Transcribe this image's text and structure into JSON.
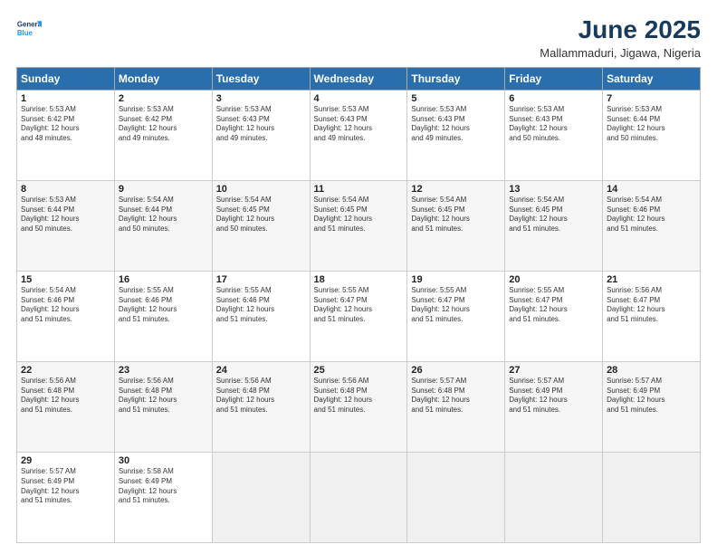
{
  "header": {
    "logo_line1": "General",
    "logo_line2": "Blue",
    "title": "June 2025",
    "subtitle": "Mallammaduri, Jigawa, Nigeria"
  },
  "days_of_week": [
    "Sunday",
    "Monday",
    "Tuesday",
    "Wednesday",
    "Thursday",
    "Friday",
    "Saturday"
  ],
  "weeks": [
    [
      {
        "day": "1",
        "detail": "Sunrise: 5:53 AM\nSunset: 6:42 PM\nDaylight: 12 hours\nand 48 minutes."
      },
      {
        "day": "2",
        "detail": "Sunrise: 5:53 AM\nSunset: 6:42 PM\nDaylight: 12 hours\nand 49 minutes."
      },
      {
        "day": "3",
        "detail": "Sunrise: 5:53 AM\nSunset: 6:43 PM\nDaylight: 12 hours\nand 49 minutes."
      },
      {
        "day": "4",
        "detail": "Sunrise: 5:53 AM\nSunset: 6:43 PM\nDaylight: 12 hours\nand 49 minutes."
      },
      {
        "day": "5",
        "detail": "Sunrise: 5:53 AM\nSunset: 6:43 PM\nDaylight: 12 hours\nand 49 minutes."
      },
      {
        "day": "6",
        "detail": "Sunrise: 5:53 AM\nSunset: 6:43 PM\nDaylight: 12 hours\nand 50 minutes."
      },
      {
        "day": "7",
        "detail": "Sunrise: 5:53 AM\nSunset: 6:44 PM\nDaylight: 12 hours\nand 50 minutes."
      }
    ],
    [
      {
        "day": "8",
        "detail": "Sunrise: 5:53 AM\nSunset: 6:44 PM\nDaylight: 12 hours\nand 50 minutes."
      },
      {
        "day": "9",
        "detail": "Sunrise: 5:54 AM\nSunset: 6:44 PM\nDaylight: 12 hours\nand 50 minutes."
      },
      {
        "day": "10",
        "detail": "Sunrise: 5:54 AM\nSunset: 6:45 PM\nDaylight: 12 hours\nand 50 minutes."
      },
      {
        "day": "11",
        "detail": "Sunrise: 5:54 AM\nSunset: 6:45 PM\nDaylight: 12 hours\nand 51 minutes."
      },
      {
        "day": "12",
        "detail": "Sunrise: 5:54 AM\nSunset: 6:45 PM\nDaylight: 12 hours\nand 51 minutes."
      },
      {
        "day": "13",
        "detail": "Sunrise: 5:54 AM\nSunset: 6:45 PM\nDaylight: 12 hours\nand 51 minutes."
      },
      {
        "day": "14",
        "detail": "Sunrise: 5:54 AM\nSunset: 6:46 PM\nDaylight: 12 hours\nand 51 minutes."
      }
    ],
    [
      {
        "day": "15",
        "detail": "Sunrise: 5:54 AM\nSunset: 6:46 PM\nDaylight: 12 hours\nand 51 minutes."
      },
      {
        "day": "16",
        "detail": "Sunrise: 5:55 AM\nSunset: 6:46 PM\nDaylight: 12 hours\nand 51 minutes."
      },
      {
        "day": "17",
        "detail": "Sunrise: 5:55 AM\nSunset: 6:46 PM\nDaylight: 12 hours\nand 51 minutes."
      },
      {
        "day": "18",
        "detail": "Sunrise: 5:55 AM\nSunset: 6:47 PM\nDaylight: 12 hours\nand 51 minutes."
      },
      {
        "day": "19",
        "detail": "Sunrise: 5:55 AM\nSunset: 6:47 PM\nDaylight: 12 hours\nand 51 minutes."
      },
      {
        "day": "20",
        "detail": "Sunrise: 5:55 AM\nSunset: 6:47 PM\nDaylight: 12 hours\nand 51 minutes."
      },
      {
        "day": "21",
        "detail": "Sunrise: 5:56 AM\nSunset: 6:47 PM\nDaylight: 12 hours\nand 51 minutes."
      }
    ],
    [
      {
        "day": "22",
        "detail": "Sunrise: 5:56 AM\nSunset: 6:48 PM\nDaylight: 12 hours\nand 51 minutes."
      },
      {
        "day": "23",
        "detail": "Sunrise: 5:56 AM\nSunset: 6:48 PM\nDaylight: 12 hours\nand 51 minutes."
      },
      {
        "day": "24",
        "detail": "Sunrise: 5:56 AM\nSunset: 6:48 PM\nDaylight: 12 hours\nand 51 minutes."
      },
      {
        "day": "25",
        "detail": "Sunrise: 5:56 AM\nSunset: 6:48 PM\nDaylight: 12 hours\nand 51 minutes."
      },
      {
        "day": "26",
        "detail": "Sunrise: 5:57 AM\nSunset: 6:48 PM\nDaylight: 12 hours\nand 51 minutes."
      },
      {
        "day": "27",
        "detail": "Sunrise: 5:57 AM\nSunset: 6:49 PM\nDaylight: 12 hours\nand 51 minutes."
      },
      {
        "day": "28",
        "detail": "Sunrise: 5:57 AM\nSunset: 6:49 PM\nDaylight: 12 hours\nand 51 minutes."
      }
    ],
    [
      {
        "day": "29",
        "detail": "Sunrise: 5:57 AM\nSunset: 6:49 PM\nDaylight: 12 hours\nand 51 minutes."
      },
      {
        "day": "30",
        "detail": "Sunrise: 5:58 AM\nSunset: 6:49 PM\nDaylight: 12 hours\nand 51 minutes."
      },
      {
        "day": "",
        "detail": ""
      },
      {
        "day": "",
        "detail": ""
      },
      {
        "day": "",
        "detail": ""
      },
      {
        "day": "",
        "detail": ""
      },
      {
        "day": "",
        "detail": ""
      }
    ]
  ]
}
